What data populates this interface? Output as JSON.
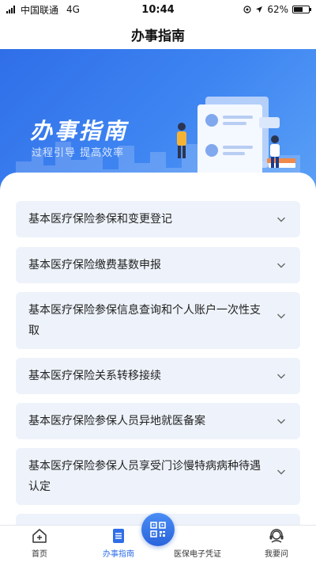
{
  "status_bar": {
    "carrier": "中国联通",
    "network": "4G",
    "time": "10:44",
    "battery_percent": "62%",
    "battery_level": 0.62
  },
  "nav": {
    "title": "办事指南"
  },
  "banner": {
    "title": "办事指南",
    "subtitle": "过程引导  提高效率"
  },
  "guide_items": [
    {
      "label": "基本医疗保险参保和变更登记"
    },
    {
      "label": "基本医疗保险缴费基数申报"
    },
    {
      "label": "基本医疗保险参保信息查询和个人账户一次性支取"
    },
    {
      "label": "基本医疗保险关系转移接续"
    },
    {
      "label": "基本医疗保险参保人员异地就医备案"
    },
    {
      "label": "基本医疗保险参保人员享受门诊慢特病病种待遇认定"
    }
  ],
  "tab_bar": {
    "home": "首页",
    "guide": "办事指南",
    "voucher": "医保电子凭证",
    "ask": "我要问"
  },
  "colors": {
    "accent": "#2f6ee8",
    "card_bg": "#eef3fb"
  },
  "icons": [
    "signal-icon",
    "location-arrow-icon",
    "battery-icon",
    "chevron-down-icon",
    "home-icon",
    "guide-doc-icon",
    "qr-code-icon",
    "headset-icon"
  ]
}
